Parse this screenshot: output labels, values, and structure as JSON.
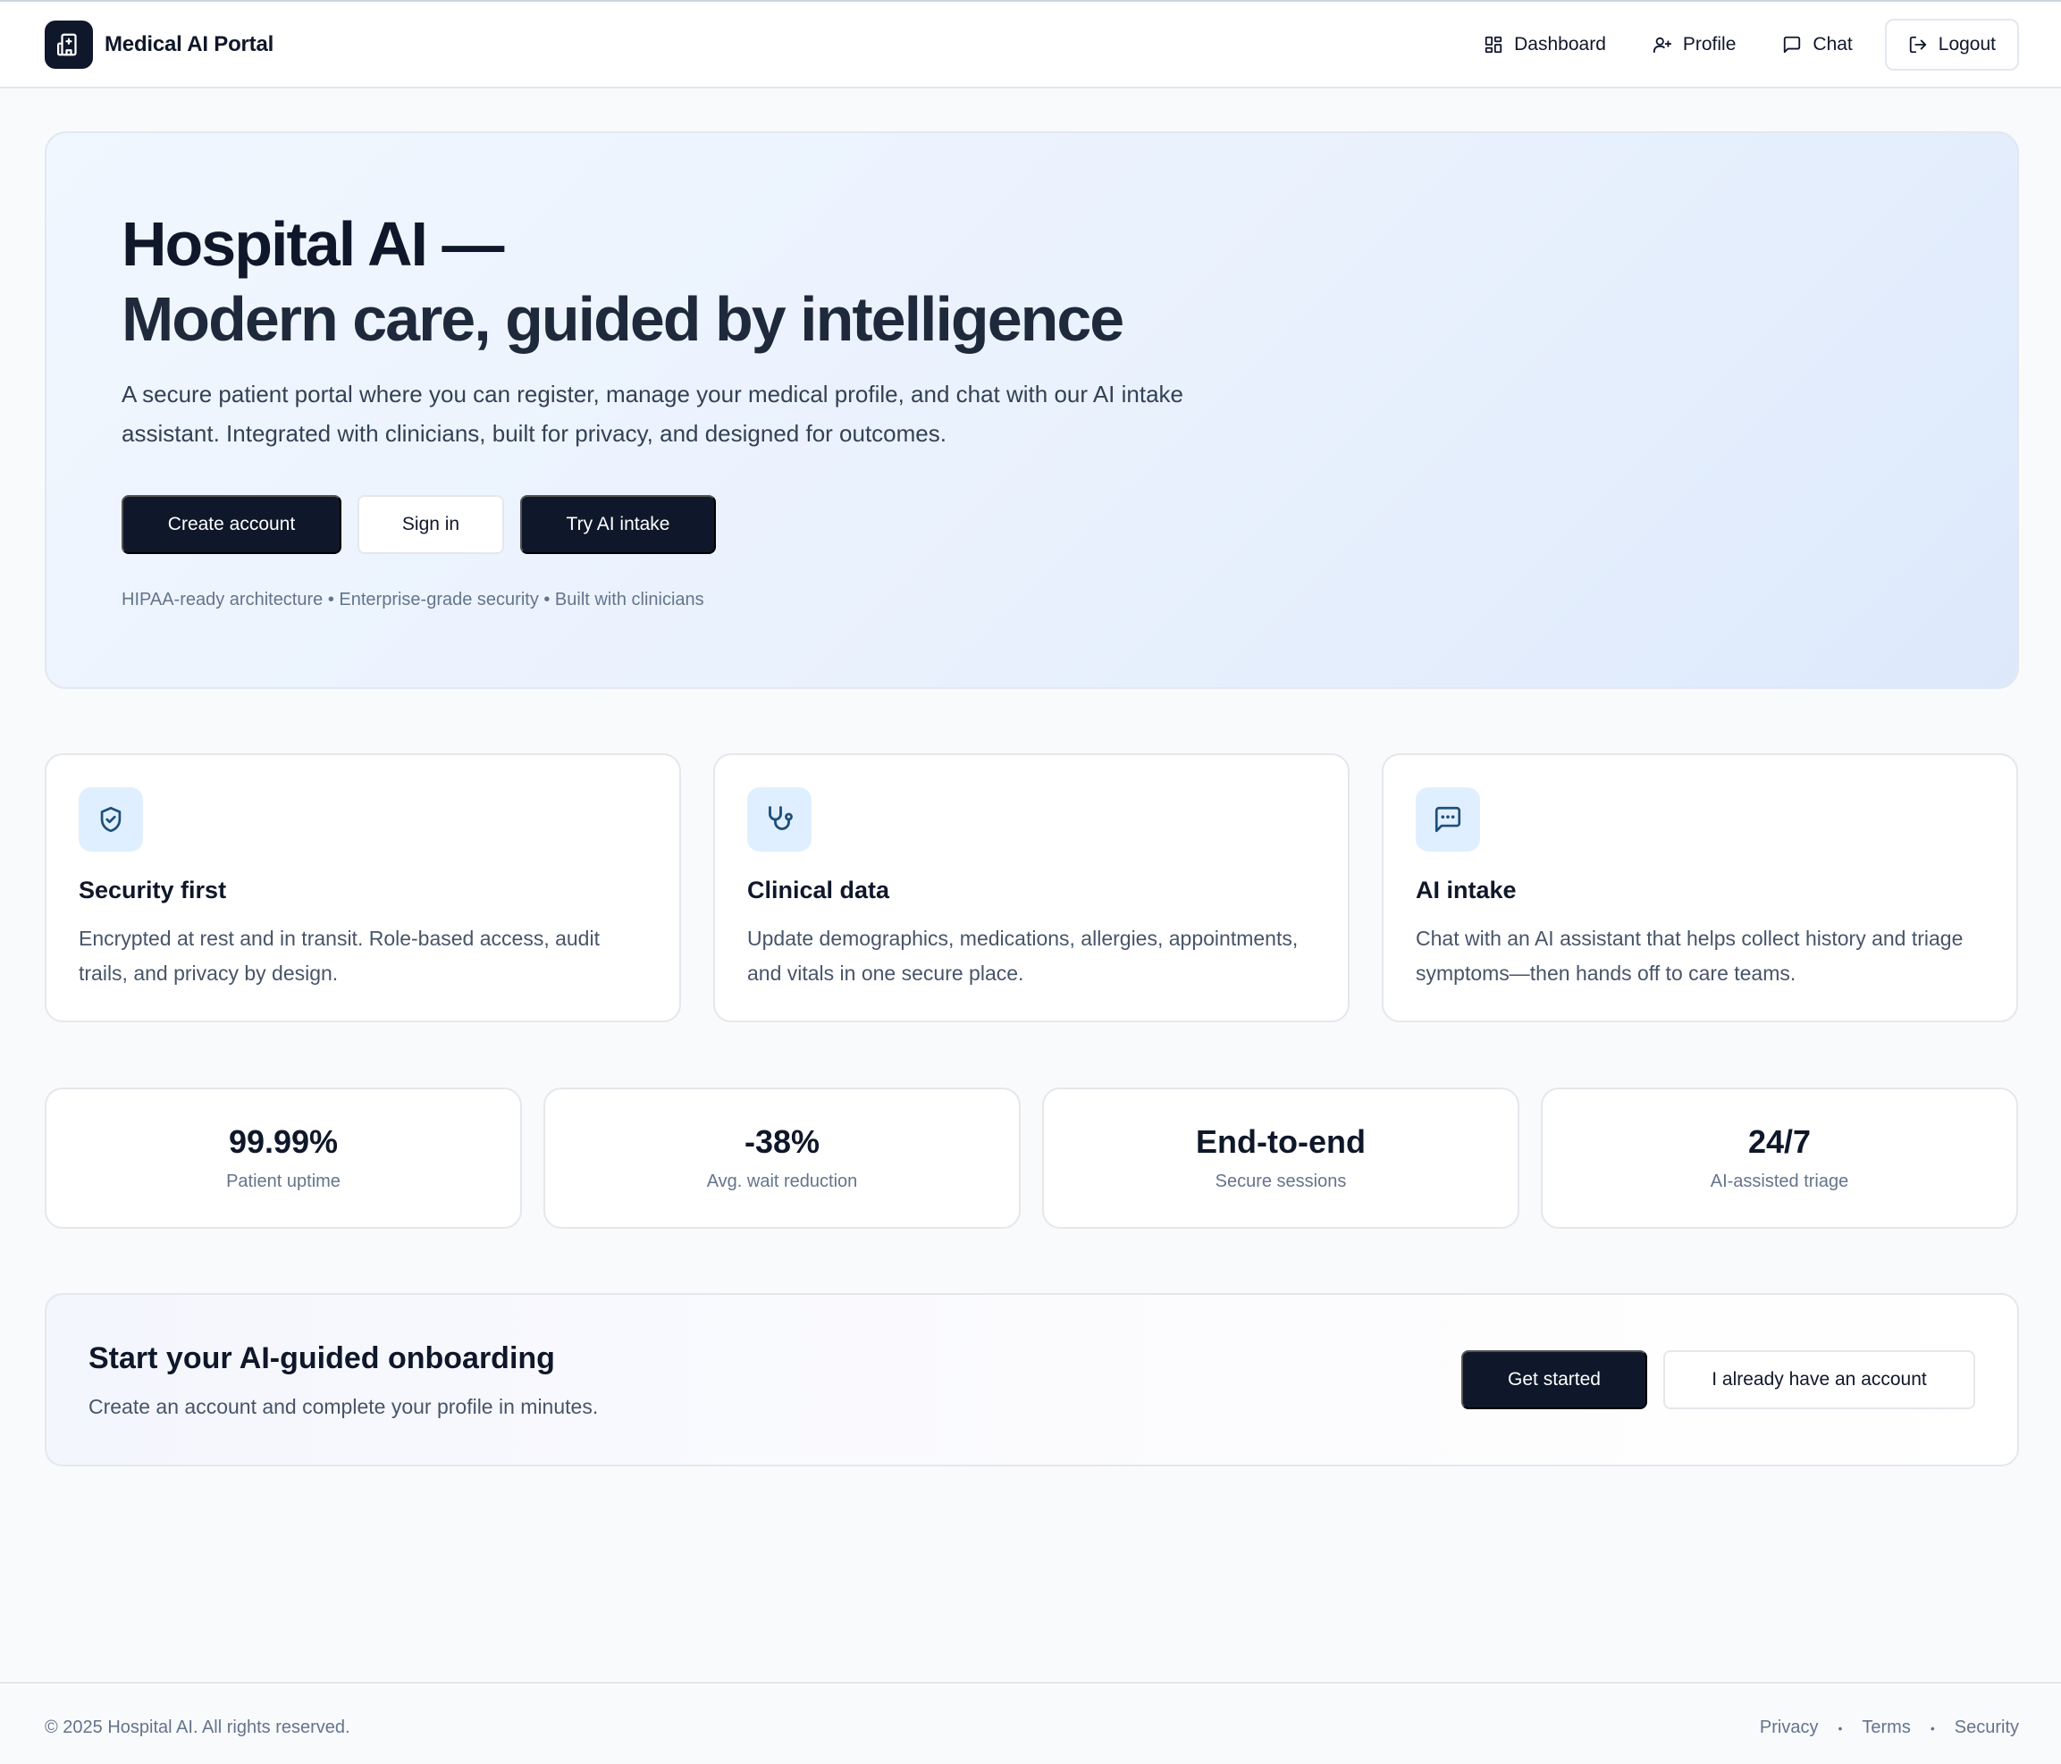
{
  "app": {
    "name": "Medical AI Portal",
    "logo_icon": "hospital-building-icon"
  },
  "nav": {
    "dashboard": "Dashboard",
    "profile": "Profile",
    "chat": "Chat",
    "logout": "Logout"
  },
  "hero": {
    "title_line1": "Hospital AI —",
    "title_line2": "Modern care, guided by intelligence",
    "subtitle": "A secure patient portal where you can register, manage your medical profile, and chat with our AI intake assistant. Integrated with clinicians, built for privacy, and designed for outcomes.",
    "buttons": {
      "create_account": "Create account",
      "sign_in": "Sign in",
      "try_ai_intake": "Try AI intake"
    },
    "tagline": "HIPAA-ready architecture • Enterprise-grade security • Built with clinicians"
  },
  "features": [
    {
      "icon": "shield-check-icon",
      "title": "Security first",
      "description": "Encrypted at rest and in transit. Role-based access, audit trails, and privacy by design."
    },
    {
      "icon": "stethoscope-icon",
      "title": "Clinical data",
      "description": "Update demographics, medications, allergies, appointments, and vitals in one secure place."
    },
    {
      "icon": "message-dots-icon",
      "title": "AI intake",
      "description": "Chat with an AI assistant that helps collect history and triage symptoms—then hands off to care teams."
    }
  ],
  "stats": [
    {
      "value": "99.99%",
      "label": "Patient uptime"
    },
    {
      "value": "-38%",
      "label": "Avg. wait reduction"
    },
    {
      "value": "End-to-end",
      "label": "Secure sessions"
    },
    {
      "value": "24/7",
      "label": "AI-assisted triage"
    }
  ],
  "cta": {
    "title": "Start your AI-guided onboarding",
    "subtitle": "Create an account and complete your profile in minutes.",
    "get_started": "Get started",
    "have_account": "I already have an account"
  },
  "footer": {
    "copyright": "© 2025 Hospital AI. All rights reserved.",
    "links": [
      "Privacy",
      "Terms",
      "Security"
    ]
  },
  "colors": {
    "primary_dark": "#0f172a",
    "icon_bg": "#e0efff",
    "icon_stroke": "#1e4f7a",
    "muted_text": "#64748b"
  }
}
